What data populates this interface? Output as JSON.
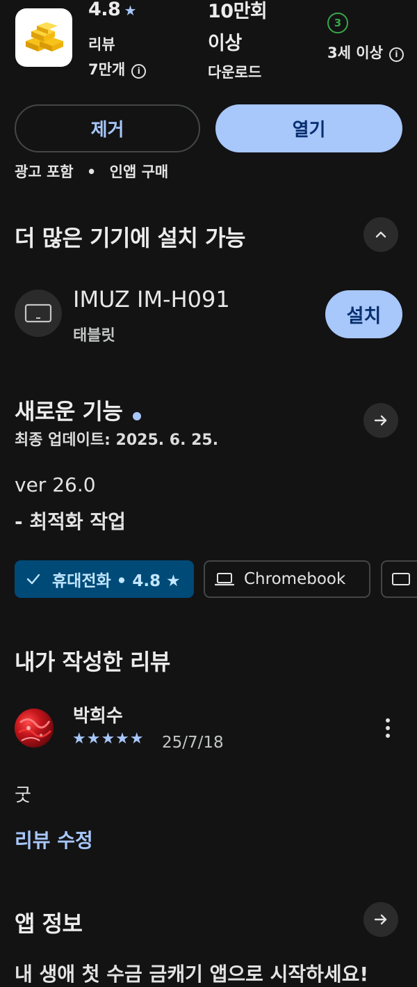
{
  "header": {
    "rating": "4.8",
    "rating_star": "★",
    "reviews_label": "리뷰",
    "reviews_count": "7만개",
    "downloads_value_line1": "10만회",
    "downloads_value_line2": "이상",
    "downloads_label": "다운로드",
    "age_badge_number": "3",
    "age_label": "3세 이상",
    "info_glyph": "i"
  },
  "actions": {
    "uninstall_label": "제거",
    "open_label": "열기"
  },
  "meta": {
    "ads": "광고 포함",
    "separator": "•",
    "iap": "인앱 구매"
  },
  "devices_section": {
    "title": "더 많은 기기에 설치 가능",
    "device_name": "IMUZ IM-H091",
    "device_type": "태블릿",
    "install_label": "설치"
  },
  "whats_new": {
    "title": "새로운 기능",
    "updated": "최종 업데이트: 2025. 6. 25.",
    "version_line": "ver 26.0",
    "note_line": "- 최적화 작업"
  },
  "device_chips": [
    {
      "label": "휴대전화 • 4.8 ★",
      "selected": true
    },
    {
      "label": "Chromebook",
      "selected": false
    },
    {
      "label": "",
      "selected": false
    }
  ],
  "my_review": {
    "title": "내가 작성한 리뷰",
    "author": "박희수",
    "stars": "★★★★★",
    "date": "25/7/18",
    "text": "굿",
    "edit_label": "리뷰 수정"
  },
  "app_info": {
    "title": "앱 정보",
    "description_partial": "내 생애 첫 수금 금캐기 앱으로 시작하세요!"
  },
  "colors": {
    "background": "#131314",
    "accent": "#a8c7fa",
    "accent_dark_text": "#062e6f",
    "chip_selected_bg": "#004a77",
    "age_badge": "#37a84a"
  }
}
